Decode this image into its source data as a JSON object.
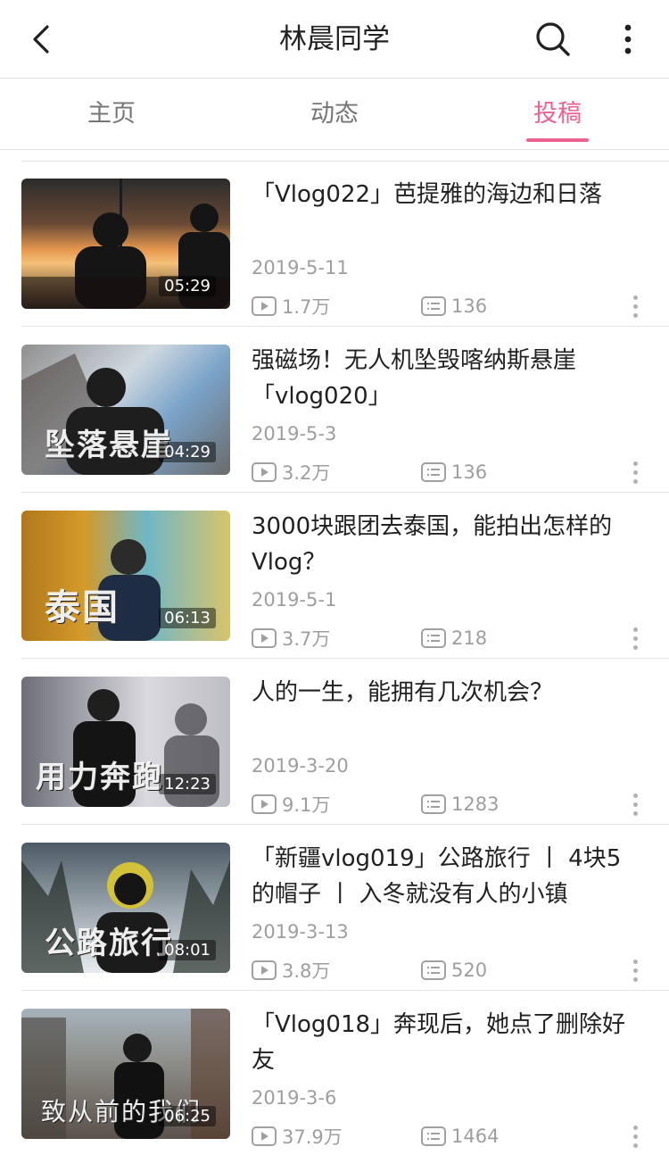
{
  "header": {
    "title": "林晨同学"
  },
  "tabs": [
    {
      "label": "主页"
    },
    {
      "label": "动态"
    },
    {
      "label": "投稿"
    }
  ],
  "active_tab": "投稿",
  "videos": [
    {
      "title": "「Vlog022」芭提雅的海边和日落",
      "date": "2019-5-11",
      "duration": "05:29",
      "plays": "1.7万",
      "comments": "136",
      "thumb_caption": ""
    },
    {
      "title": "强磁场！无人机坠毁喀纳斯悬崖「vlog020」",
      "date": "2019-5-3",
      "duration": "04:29",
      "plays": "3.2万",
      "comments": "136",
      "thumb_caption": "坠落悬崖"
    },
    {
      "title": "3000块跟团去泰国，能拍出怎样的Vlog？",
      "date": "2019-5-1",
      "duration": "06:13",
      "plays": "3.7万",
      "comments": "218",
      "thumb_caption": "泰国"
    },
    {
      "title": "人的一生，能拥有几次机会？",
      "date": "2019-3-20",
      "duration": "12:23",
      "plays": "9.1万",
      "comments": "1283",
      "thumb_caption": "用力奔跑"
    },
    {
      "title": "「新疆vlog019」公路旅行 丨 4块5的帽子 丨 入冬就没有人的小镇",
      "date": "2019-3-13",
      "duration": "08:01",
      "plays": "3.8万",
      "comments": "520",
      "thumb_caption": "公路旅行"
    },
    {
      "title": "「Vlog018」奔现后，她点了删除好友",
      "date": "2019-3-6",
      "duration": "06:25",
      "plays": "37.9万",
      "comments": "1464",
      "thumb_caption": "致从前的我们"
    }
  ],
  "colors": {
    "accent": "#f06292",
    "text": "#212121",
    "meta": "#9e9e9e"
  },
  "icons": [
    "back-arrow-icon",
    "search-icon",
    "more-vertical-icon",
    "play-count-icon",
    "comment-icon",
    "item-menu-icon"
  ]
}
